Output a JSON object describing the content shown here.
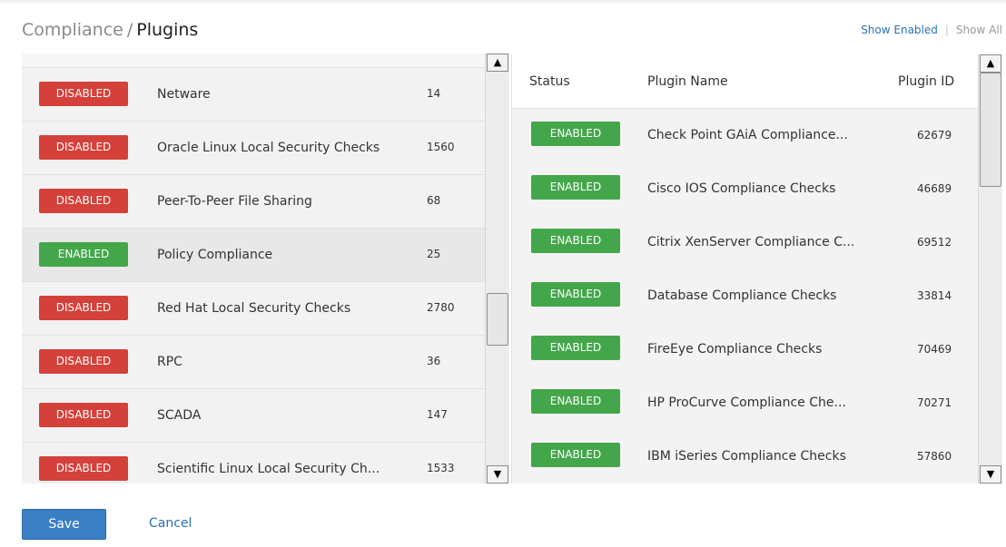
{
  "header": {
    "breadcrumb_parent": "Compliance",
    "breadcrumb_separator": "/",
    "title": "Plugins"
  },
  "filter": {
    "show_enabled": "Show Enabled",
    "separator": "|",
    "show_all": "Show All"
  },
  "families": [
    {
      "status": "DISABLED",
      "name": "Netware",
      "count": "14"
    },
    {
      "status": "DISABLED",
      "name": "Oracle Linux Local Security Checks",
      "count": "1560"
    },
    {
      "status": "DISABLED",
      "name": "Peer-To-Peer File Sharing",
      "count": "68"
    },
    {
      "status": "ENABLED",
      "name": "Policy Compliance",
      "count": "25"
    },
    {
      "status": "DISABLED",
      "name": "Red Hat Local Security Checks",
      "count": "2780"
    },
    {
      "status": "DISABLED",
      "name": "RPC",
      "count": "36"
    },
    {
      "status": "DISABLED",
      "name": "SCADA",
      "count": "147"
    },
    {
      "status": "DISABLED",
      "name": "Scientific Linux Local Security Ch...",
      "count": "1533"
    }
  ],
  "plugins_table": {
    "columns": {
      "status": "Status",
      "name": "Plugin Name",
      "id": "Plugin ID"
    },
    "rows": [
      {
        "status": "ENABLED",
        "name": "Check Point GAiA Compliance...",
        "id": "62679"
      },
      {
        "status": "ENABLED",
        "name": "Cisco IOS Compliance Checks",
        "id": "46689"
      },
      {
        "status": "ENABLED",
        "name": "Citrix XenServer Compliance C...",
        "id": "69512"
      },
      {
        "status": "ENABLED",
        "name": "Database Compliance Checks",
        "id": "33814"
      },
      {
        "status": "ENABLED",
        "name": "FireEye Compliance Checks",
        "id": "70469"
      },
      {
        "status": "ENABLED",
        "name": "HP ProCurve Compliance Che...",
        "id": "70271"
      },
      {
        "status": "ENABLED",
        "name": "IBM iSeries Compliance Checks",
        "id": "57860"
      }
    ]
  },
  "actions": {
    "save": "Save",
    "cancel": "Cancel"
  },
  "icons": {
    "scroll_up": "arrow-up-icon",
    "scroll_down": "arrow-down-icon"
  },
  "colors": {
    "disabled": "#d4413a",
    "enabled": "#44a64a",
    "primary": "#3a7fc4",
    "link": "#2a70b8"
  }
}
